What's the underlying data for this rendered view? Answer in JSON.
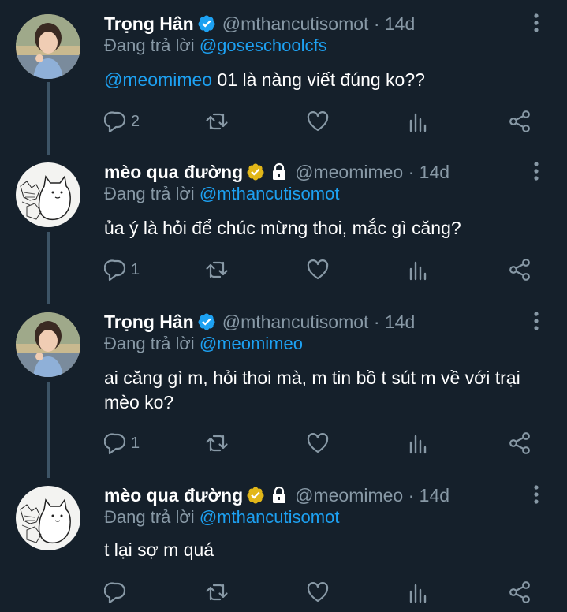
{
  "theme": {
    "background": "#15202b",
    "text": "#ffffff",
    "muted": "#8899a6",
    "link": "#1da1f2",
    "verified_blue": "#1da1f2",
    "verified_gold": "#e2b719"
  },
  "reply_to_prefix": "Đang trả lời",
  "tweets": [
    {
      "name": "Trọng Hân",
      "badge": "verified-blue",
      "handle": "@mthancutisomot · 14d",
      "reply_to": "@goseschoolcfs",
      "mention": "@meomimeo",
      "text": " 01 là nàng viết đúng ko??",
      "replies": "2"
    },
    {
      "name": "mèo qua đường",
      "badge": "verified-gold",
      "locked": true,
      "handle": "@meomimeo · 14d",
      "reply_to": "@mthancutisomot",
      "mention": "",
      "text": "ủa ý là hỏi để chúc mừng thoi, mắc gì căng?",
      "replies": "1"
    },
    {
      "name": "Trọng Hân",
      "badge": "verified-blue",
      "handle": "@mthancutisomot · 14d",
      "reply_to": "@meomimeo",
      "mention": "",
      "text": "ai căng gì m, hỏi thoi mà, m tin bồ t sút m về với trại mèo ko?",
      "replies": "1"
    },
    {
      "name": "mèo qua đường",
      "badge": "verified-gold",
      "locked": true,
      "handle": "@meomimeo · 14d",
      "reply_to": "@mthancutisomot",
      "mention": "",
      "text": "t lại sợ m quá",
      "replies": ""
    }
  ]
}
